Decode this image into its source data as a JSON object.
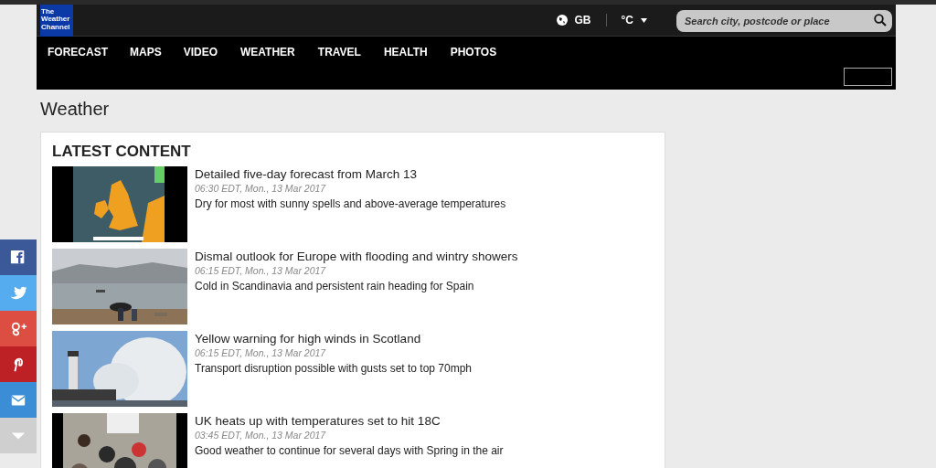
{
  "header": {
    "logo": "The Weather Channel",
    "region": "GB",
    "unit": "°C",
    "search": {
      "placeholder": "Search city, postcode or place"
    }
  },
  "nav": [
    {
      "label": "FORECAST"
    },
    {
      "label": "MAPS"
    },
    {
      "label": "VIDEO"
    },
    {
      "label": "WEATHER"
    },
    {
      "label": "TRAVEL"
    },
    {
      "label": "HEALTH"
    },
    {
      "label": "PHOTOS"
    }
  ],
  "page_title": "Weather",
  "section_title": "LATEST CONTENT",
  "articles": [
    {
      "title": "Detailed five-day forecast from March 13",
      "time": "06:30 EDT, Mon., 13 Mar 2017",
      "summary": "Dry for most with sunny spells and above-average temperatures"
    },
    {
      "title": "Dismal outlook for Europe with flooding and wintry showers",
      "time": "06:15 EDT, Mon., 13 Mar 2017",
      "summary": "Cold in Scandinavia and persistent rain heading for Spain"
    },
    {
      "title": "Yellow warning for high winds in Scotland",
      "time": "06:15 EDT, Mon., 13 Mar 2017",
      "summary": "Transport disruption possible with gusts set to top 70mph"
    },
    {
      "title": "UK heats up with temperatures set to hit 18C",
      "time": "03:45 EDT, Mon., 13 Mar 2017",
      "summary": "Good weather to continue for several days with Spring in the air"
    }
  ],
  "share": [
    {
      "kind": "facebook"
    },
    {
      "kind": "twitter"
    },
    {
      "kind": "googleplus"
    },
    {
      "kind": "pinterest"
    },
    {
      "kind": "email"
    },
    {
      "kind": "more"
    }
  ]
}
